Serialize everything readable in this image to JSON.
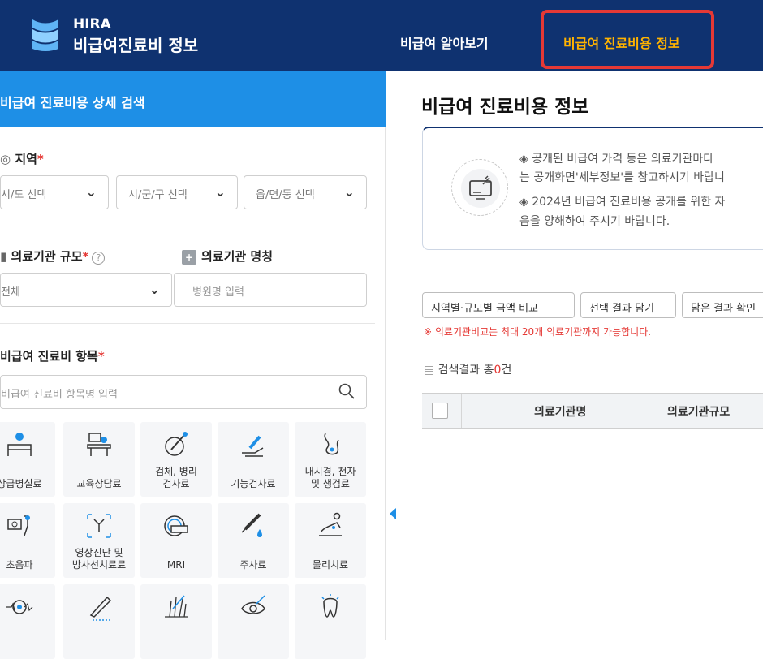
{
  "header": {
    "logo_line1": "HIRA",
    "logo_line2": "비급여진료비 정보",
    "nav": [
      {
        "label": "비급여 알아보기"
      },
      {
        "label": "비급여 진료비용 정보"
      }
    ]
  },
  "left": {
    "title": "비급여 진료비용 상세 검색",
    "region": {
      "label": "지역",
      "required_mark": "*",
      "selects": [
        {
          "value": "시/도 선택"
        },
        {
          "value": "시/군/구 선택"
        },
        {
          "value": "읍/면/동 선택"
        }
      ]
    },
    "scale": {
      "label": "의료기관 규모",
      "required_mark": "*",
      "help": "?",
      "value": "전체"
    },
    "name": {
      "label": "의료기관 명칭",
      "placeholder": "병원명 입력"
    },
    "items": {
      "label": "비급여 진료비 항목",
      "required_mark": "*",
      "placeholder": "비급여 진료비 항목명 입력",
      "tiles": [
        {
          "label": "상급병실료",
          "icon": "bed-icon"
        },
        {
          "label": "교육상담료",
          "icon": "consult-icon"
        },
        {
          "label": "검체, 병리\n검사료",
          "icon": "test-tube-icon"
        },
        {
          "label": "기능검사료",
          "icon": "function-test-icon"
        },
        {
          "label": "내시경, 천자\n및 생검료",
          "icon": "endoscope-icon"
        },
        {
          "label": "초음파",
          "icon": "ultrasound-icon"
        },
        {
          "label": "영상진단 및\n방사선치료료",
          "icon": "xray-icon"
        },
        {
          "label": "MRI",
          "icon": "mri-icon"
        },
        {
          "label": "주사료",
          "icon": "syringe-icon"
        },
        {
          "label": "물리치료",
          "icon": "physio-icon"
        },
        {
          "label": "",
          "icon": "virus-icon"
        },
        {
          "label": "",
          "icon": "pen-icon"
        },
        {
          "label": "",
          "icon": "hair-icon"
        },
        {
          "label": "",
          "icon": "eye-icon"
        },
        {
          "label": "",
          "icon": "tooth-icon"
        }
      ]
    }
  },
  "right": {
    "title": "비급여 진료비용 정보",
    "notice_lines": [
      "◈ 공개된 비급여 가격 등은 의료기관마다",
      "는 공개화면'세부정보'를 참고하시기 바랍니",
      "◈ 2024년 비급여 진료비용 공개를 위한 자",
      "음을 양해하여 주시기 바랍니다."
    ],
    "buttons": [
      {
        "label": "지역별·규모별 금액 비교"
      },
      {
        "label": "선택 결과 담기"
      },
      {
        "label": "담은 결과 확인"
      }
    ],
    "note": "※ 의료기관비교는 최대 20개 의료기관까지 가능합니다.",
    "result_prefix": "검색결과 총",
    "result_count": "0",
    "result_suffix": "건",
    "table_headers": [
      "의료기관명",
      "의료기관규모"
    ]
  },
  "colors": {
    "header_bg": "#0f3270",
    "accent_blue": "#1e8fe6",
    "nav_active": "#ffb300",
    "highlight_border": "#e53935"
  }
}
